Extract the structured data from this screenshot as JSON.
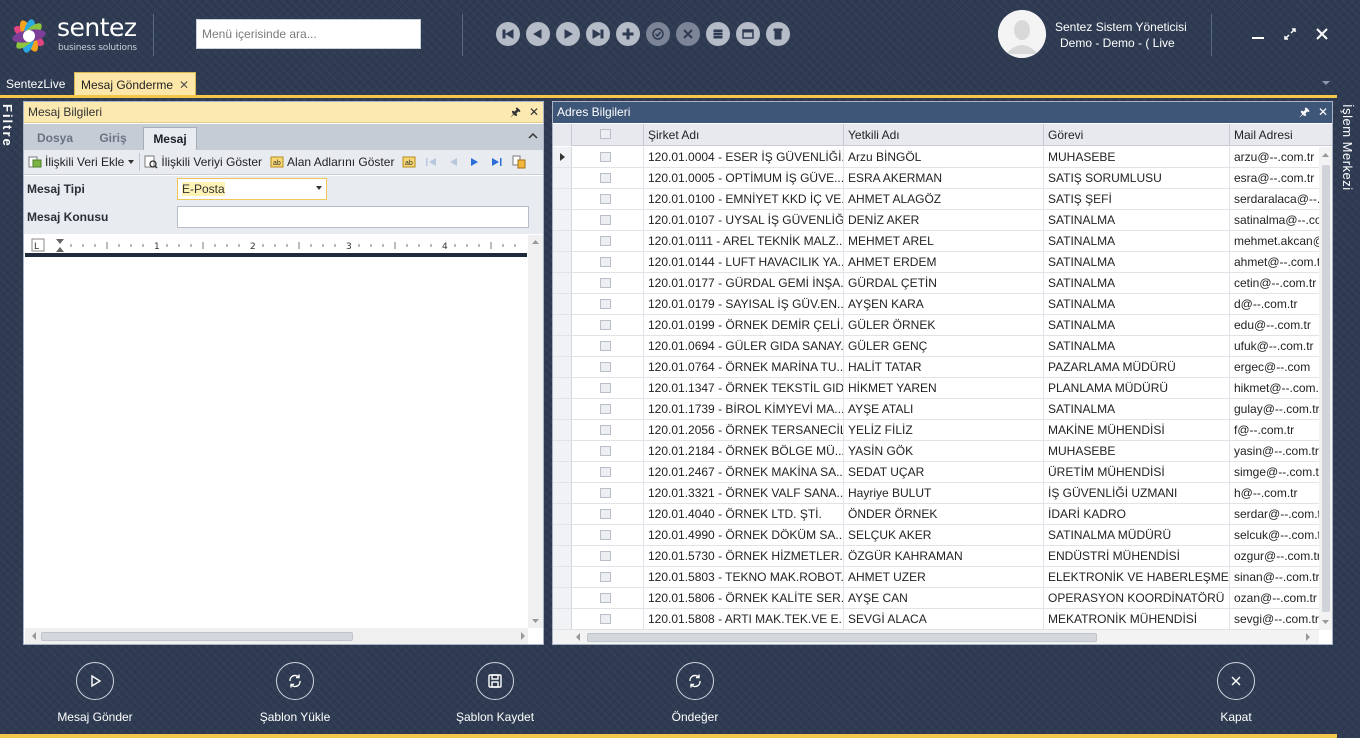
{
  "app": {
    "logo_text": "sentez",
    "logo_sub": "business solutions"
  },
  "search": {
    "placeholder": "Menü içerisinde ara..."
  },
  "toolbar_icons": [
    "first-record-icon",
    "previous-record-icon",
    "next-record-icon",
    "last-record-icon",
    "add-icon",
    "approve-icon",
    "cancel-icon",
    "list-icon",
    "window-icon",
    "delete-icon"
  ],
  "user": {
    "name": "Sentez Sistem Yöneticisi",
    "company": "Demo - Demo - ( Live"
  },
  "tabs": {
    "sentezlive": "SentezLive",
    "mesaj": "Mesaj Gönderme"
  },
  "side": {
    "filtre": "Filtre",
    "islem": "İşlem Merkezi"
  },
  "left_panel": {
    "title": "Mesaj Bilgileri",
    "ribbon_tabs": [
      "Dosya",
      "Giriş",
      "Mesaj"
    ],
    "active_tab": "Mesaj",
    "buttons": {
      "iliskili_veri_ekle": "İlişkili Veri Ekle",
      "iliskili_veriyi_goster": "İlişkili Veriyi Göster",
      "alan_adlarini_goster": "Alan Adlarını Göster"
    },
    "form": {
      "tip_label": "Mesaj Tipi",
      "tip_value": "E-Posta",
      "konu_label": "Mesaj Konusu",
      "konu_value": ""
    },
    "ruler_numbers": [
      "1",
      "2",
      "3",
      "4"
    ]
  },
  "right_panel": {
    "title": "Adres Bilgileri",
    "columns": [
      "Şirket Adı",
      "Yetkili Adı",
      "Görevi",
      "Mail Adresi"
    ],
    "rows": [
      [
        "120.01.0004 - ESER İŞ GÜVENLİĞİ...",
        "Arzu BİNGÖL",
        "MUHASEBE",
        "arzu@--.com.tr"
      ],
      [
        "120.01.0005 - OPTİMUM İŞ GÜVE...",
        "ESRA AKERMAN",
        "SATIŞ SORUMLUSU",
        "esra@--.com.tr"
      ],
      [
        "120.01.0100 - EMNİYET KKD İÇ VE...",
        "AHMET ALAGÖZ",
        "SATIŞ ŞEFİ",
        "serdaralaca@--.com.tr"
      ],
      [
        "120.01.0107 - UYSAL İŞ GÜVENLİĞ...",
        "DENİZ AKER",
        "SATINALMA",
        "satinalma@--.com.tr"
      ],
      [
        "120.01.0111 - AREL TEKNİK MALZ...",
        "MEHMET AREL",
        "SATINALMA",
        "mehmet.akcan@--.com.tr"
      ],
      [
        "120.01.0144 - LUFT HAVACILIK YA...",
        "AHMET ERDEM",
        "SATINALMA",
        "ahmet@--.com.tr"
      ],
      [
        "120.01.0177 - GÜRDAL GEMİ İNŞA...",
        "GÜRDAL ÇETİN",
        "SATINALMA",
        "cetin@--.com.tr"
      ],
      [
        "120.01.0179 - SAYISAL İŞ GÜV.EN...",
        "AYŞEN KARA",
        "SATINALMA",
        "d@--.com.tr"
      ],
      [
        "120.01.0199 - ÖRNEK DEMİR ÇELİ...",
        "GÜLER ÖRNEK",
        "SATINALMA",
        "edu@--.com.tr"
      ],
      [
        "120.01.0694 - GÜLER GIDA SANAY...",
        "GÜLER GENÇ",
        "SATINALMA",
        "ufuk@--.com.tr"
      ],
      [
        "120.01.0764 - ÖRNEK MARİNA TU...",
        "HALİT TATAR",
        "PAZARLAMA MÜDÜRÜ",
        "ergec@--.com"
      ],
      [
        "120.01.1347 - ÖRNEK TEKSTİL GID...",
        "HİKMET YAREN",
        "PLANLAMA MÜDÜRÜ",
        "hikmet@--.com.tr"
      ],
      [
        "120.01.1739 - BİROL KİMYEVİ MA...",
        "AYŞE ATALI",
        "SATINALMA",
        "gulay@--.com.tr"
      ],
      [
        "120.01.2056 - ÖRNEK TERSANECİL...",
        "YELİZ FİLİZ",
        "MAKİNE MÜHENDİSİ",
        "f@--.com.tr"
      ],
      [
        "120.01.2184 - ÖRNEK BÖLGE MÜ...",
        "YASİN GÖK",
        "MUHASEBE",
        "yasin@--.com.tr"
      ],
      [
        "120.01.2467 - ÖRNEK MAKİNA SA...",
        "SEDAT UÇAR",
        "ÜRETİM MÜHENDİSİ",
        "simge@--.com.tr"
      ],
      [
        "120.01.3321 - ÖRNEK VALF SANA...",
        "Hayriye BULUT",
        "İŞ GÜVENLİĞİ UZMANI",
        "h@--.com.tr"
      ],
      [
        "120.01.4040 - ÖRNEK LTD. ŞTİ.",
        "ÖNDER ÖRNEK",
        "İDARİ KADRO",
        "serdar@--.com.tr"
      ],
      [
        "120.01.4990 - ÖRNEK DÖKÜM SA...",
        "SELÇUK AKER",
        "SATINALMA MÜDÜRÜ",
        "selcuk@--.com.tr"
      ],
      [
        "120.01.5730 - ÖRNEK HİZMETLER...",
        "ÖZGÜR KAHRAMAN",
        "ENDÜSTRİ MÜHENDİSİ",
        "ozgur@--.com.tr"
      ],
      [
        "120.01.5803 - TEKNO MAK.ROBOT...",
        "AHMET UZER",
        "ELEKTRONİK VE HABERLEŞME...",
        "sinan@--.com.tr"
      ],
      [
        "120.01.5806 - ÖRNEK KALİTE SER...",
        "AYŞE CAN",
        "OPERASYON KOORDİNATÖRÜ",
        "ozan@--.com.tr"
      ],
      [
        "120.01.5808 - ARTI MAK.TEK.VE E...",
        "SEVGİ ALACA",
        "MEKATRONİK MÜHENDİSİ",
        "sevgi@--.com.tr"
      ]
    ]
  },
  "actions": [
    {
      "label": "Mesaj Gönder",
      "icon": "play-icon"
    },
    {
      "label": "Şablon Yükle",
      "icon": "refresh-icon"
    },
    {
      "label": "Şablon Kaydet",
      "icon": "save-icon"
    },
    {
      "label": "Öndeğer",
      "icon": "refresh-icon"
    },
    {
      "label": "Kapat",
      "icon": "close-icon"
    }
  ],
  "colors": {
    "background": "#2e3b52",
    "accent": "#f4c649",
    "left_header": "#fbe9b1",
    "right_header": "#3e5778"
  }
}
